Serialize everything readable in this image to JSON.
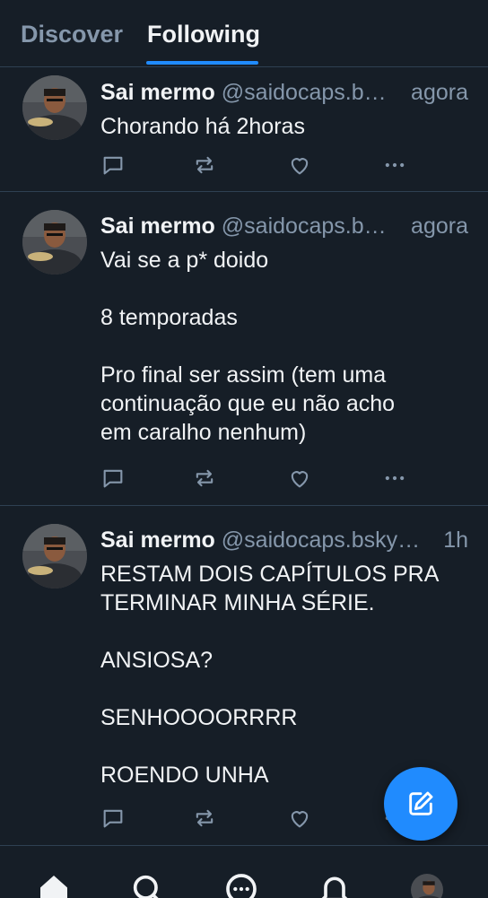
{
  "tabs": {
    "discover": "Discover",
    "following": "Following"
  },
  "posts": [
    {
      "name": "Sai mermo",
      "handle": "@saidocaps.b…",
      "time": "agora",
      "paragraphs": [
        "Chorando há 2horas"
      ]
    },
    {
      "name": "Sai mermo",
      "handle": "@saidocaps.b…",
      "time": "agora",
      "paragraphs": [
        "Vai se a p* doido",
        "",
        "8 temporadas",
        "",
        "Pro final ser assim (tem uma",
        "continuação que eu não acho",
        "em caralho nenhum)"
      ]
    },
    {
      "name": "Sai mermo",
      "handle": "@saidocaps.bsky…",
      "time": "1h",
      "paragraphs": [
        "RESTAM DOIS CAPÍTULOS PRA",
        "TERMINAR MINHA SÉRIE.",
        "",
        "ANSIOSA?",
        "",
        "SENHOOOORRRR",
        "",
        "ROENDO UNHA"
      ]
    }
  ],
  "icons": {
    "reply": "speech-bubble-icon",
    "repost": "repost-arrows-icon",
    "like": "heart-icon",
    "more": "ellipsis-icon",
    "compose": "pencil-square-icon",
    "home": "house-icon",
    "search": "magnifier-icon",
    "chat": "chat-bubble-icon",
    "notifications": "bell-icon"
  },
  "colors": {
    "background": "#161e27",
    "accent": "#208bfe",
    "muted": "#8597ab",
    "divider": "#2e4052",
    "text": "#f1f3f5"
  }
}
